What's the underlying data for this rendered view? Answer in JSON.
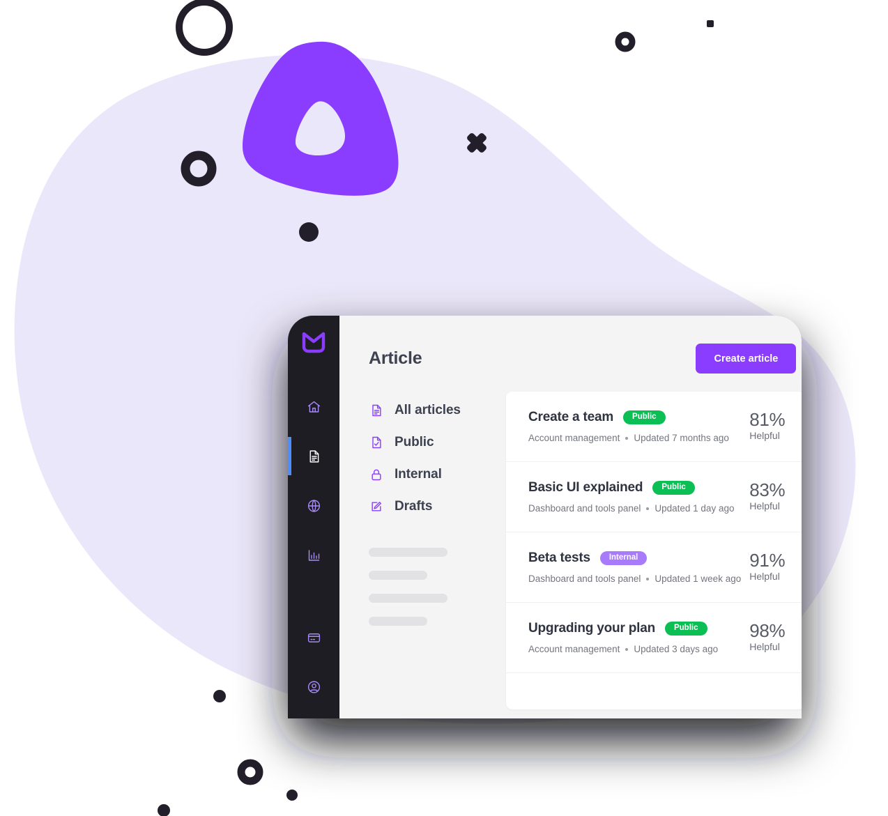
{
  "window": {
    "title": "Article"
  },
  "colors": {
    "brand_purple": "#8b3dff",
    "rail_dark": "#1e1d24",
    "active_indicator_blue": "#4c8dff",
    "badge_public_green": "#0bbf55",
    "badge_internal_purple": "#a77bfb",
    "blob_lavender": "#ebe7fa",
    "panel_bg": "#f4f4f5",
    "card_bg": "#ffffff"
  },
  "rail": {
    "logo_name": "app-logo-icon",
    "items": [
      {
        "name": "home-icon",
        "label": "Home",
        "active": false
      },
      {
        "name": "document-icon",
        "label": "Articles",
        "active": true
      },
      {
        "name": "globe-icon",
        "label": "Website",
        "active": false
      },
      {
        "name": "chart-icon",
        "label": "Reports",
        "active": false
      }
    ],
    "bottom_items": [
      {
        "name": "credit-card-icon",
        "label": "Billing",
        "active": false
      },
      {
        "name": "user-icon",
        "label": "Account",
        "active": false
      }
    ]
  },
  "toolbar": {
    "create_label": "Create article"
  },
  "nav": {
    "items": [
      {
        "label": "All articles",
        "icon": "file-text-icon"
      },
      {
        "label": "Public",
        "icon": "file-check-icon"
      },
      {
        "label": "Internal",
        "icon": "lock-icon"
      },
      {
        "label": "Drafts",
        "icon": "pencil-edit-icon"
      }
    ],
    "skeleton_widths": [
      "wide",
      "narrow",
      "wide",
      "narrow"
    ]
  },
  "articles": {
    "helpful_label": "Helpful",
    "items": [
      {
        "title": "Create a team",
        "badge": "Public",
        "badge_type": "public",
        "category": "Account management",
        "updated": "Updated 7 months ago",
        "score": "81%"
      },
      {
        "title": "Basic UI explained",
        "badge": "Public",
        "badge_type": "public",
        "category": "Dashboard and tools panel",
        "updated": "Updated 1 day ago",
        "score": "83%"
      },
      {
        "title": "Beta tests",
        "badge": "Internal",
        "badge_type": "internal",
        "category": "Dashboard and tools panel",
        "updated": "Updated 1 week ago",
        "score": "91%"
      },
      {
        "title": "Upgrading your plan",
        "badge": "Public",
        "badge_type": "public",
        "category": "Account management",
        "updated": "Updated 3 days ago",
        "score": "98%"
      }
    ]
  }
}
